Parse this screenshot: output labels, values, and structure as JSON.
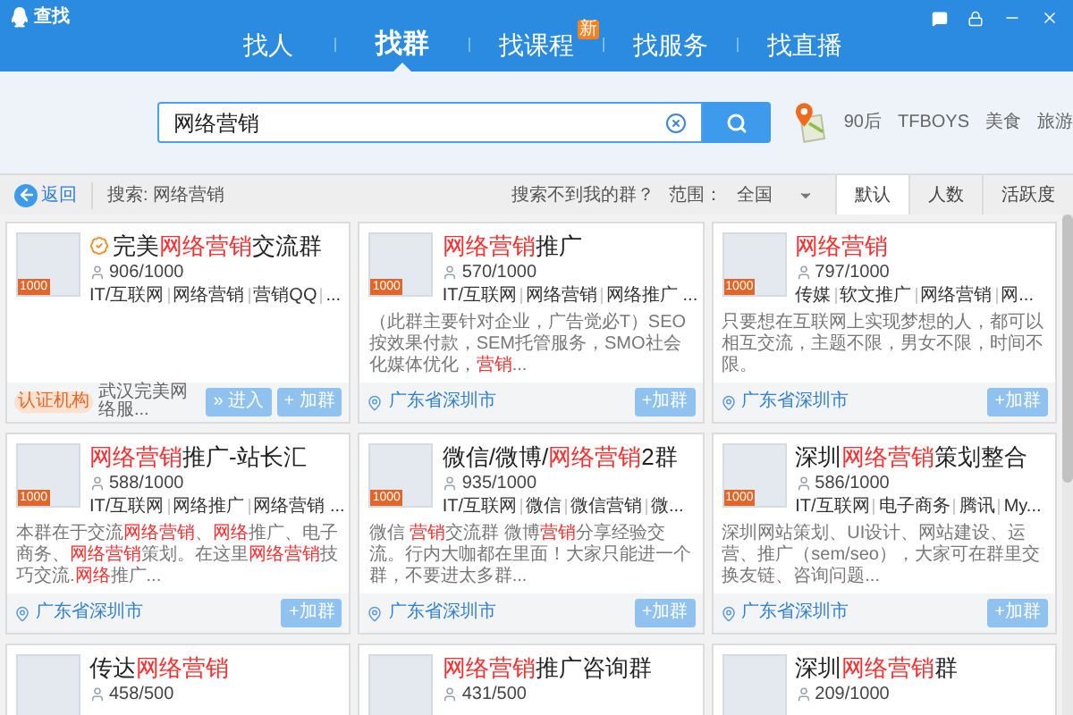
{
  "window": {
    "title": "查找"
  },
  "tabs": [
    {
      "label": "找人",
      "selected": false
    },
    {
      "label": "找群",
      "selected": true
    },
    {
      "label": "找课程",
      "selected": false,
      "badge": "新"
    },
    {
      "label": "找服务",
      "selected": false
    },
    {
      "label": "找直播",
      "selected": false
    }
  ],
  "search": {
    "value": "网络营销"
  },
  "hot_words": [
    "90后",
    "TFBOYS",
    "美食",
    "旅游"
  ],
  "toolbar": {
    "back": "返回",
    "query": "搜索: 网络营销",
    "help_link": "搜索不到我的群？",
    "range_label": "范围：",
    "range_value": "全国",
    "sort_tabs": [
      {
        "label": "默认",
        "selected": true
      },
      {
        "label": "人数",
        "selected": false
      },
      {
        "label": "活跃度",
        "selected": false
      }
    ]
  },
  "groups": [
    {
      "verified": true,
      "title": [
        {
          "text": "完美",
          "highlight": false
        },
        {
          "text": "网络营销",
          "highlight": true
        },
        {
          "text": "交流群",
          "highlight": false
        }
      ],
      "size_badge": "1000",
      "members": "906/1000",
      "tags": [
        "IT/互联网",
        "网络营销",
        "营销QQ",
        "..."
      ],
      "footer": {
        "kind": "certified",
        "badge": "认证机构",
        "text": "武汉完美网络服..."
      },
      "buttons": [
        "» 进入",
        "+ 加群"
      ]
    },
    {
      "verified": false,
      "title": [
        {
          "text": "网络营销",
          "highlight": true
        },
        {
          "text": "推广",
          "highlight": false
        }
      ],
      "size_badge": "1000",
      "members": "570/1000",
      "tags": [
        "IT/互联网",
        "网络营销",
        "网络推广 ..."
      ],
      "description": [
        {
          "text": "（此群主要针对企业，广告觉必T）SEO按效果付款，SEM托管服务，SMO社会化媒体优化，",
          "highlight": false
        },
        {
          "text": "营销",
          "highlight": true
        },
        {
          "text": "...",
          "highlight": false
        }
      ],
      "footer": {
        "kind": "location",
        "text": "广东省深圳市"
      },
      "buttons": [
        "+加群"
      ]
    },
    {
      "verified": false,
      "title": [
        {
          "text": "网络营销",
          "highlight": true
        }
      ],
      "size_badge": "1000",
      "members": "797/1000",
      "tags": [
        "传媒",
        "软文推广",
        "网络营销",
        "网..."
      ],
      "description": [
        {
          "text": "只要想在互联网上实现梦想的人，都可以相互交流，主题不限，男女不限，时间不限。",
          "highlight": false
        }
      ],
      "footer": {
        "kind": "location",
        "text": "广东省深圳市"
      },
      "buttons": [
        "+加群"
      ]
    },
    {
      "verified": false,
      "title": [
        {
          "text": "网络营销",
          "highlight": true
        },
        {
          "text": "推广-站长汇",
          "highlight": false
        }
      ],
      "size_badge": "1000",
      "members": "588/1000",
      "tags": [
        "IT/互联网",
        "网络推广",
        "网络营销 ..."
      ],
      "description": [
        {
          "text": "本群在于交流",
          "highlight": false
        },
        {
          "text": "网络营销",
          "highlight": true
        },
        {
          "text": "、",
          "highlight": false
        },
        {
          "text": "网络",
          "highlight": true
        },
        {
          "text": "推广、电子商务、",
          "highlight": false
        },
        {
          "text": "网络营销",
          "highlight": true
        },
        {
          "text": "策划。在这里",
          "highlight": false
        },
        {
          "text": "网络营销",
          "highlight": true
        },
        {
          "text": "技巧交流.",
          "highlight": false
        },
        {
          "text": "网络",
          "highlight": true
        },
        {
          "text": "推广...",
          "highlight": false
        }
      ],
      "footer": {
        "kind": "location",
        "text": "广东省深圳市"
      },
      "buttons": [
        "+加群"
      ]
    },
    {
      "verified": false,
      "title": [
        {
          "text": "微信/微博/",
          "highlight": false
        },
        {
          "text": "网络营销",
          "highlight": true
        },
        {
          "text": "2群",
          "highlight": false
        }
      ],
      "size_badge": "1000",
      "members": "935/1000",
      "tags": [
        "IT/互联网",
        "微信",
        "微信营销",
        "微..."
      ],
      "description": [
        {
          "text": "微信 ",
          "highlight": false
        },
        {
          "text": "营销",
          "highlight": true
        },
        {
          "text": "交流群 微博",
          "highlight": false
        },
        {
          "text": "营销",
          "highlight": true
        },
        {
          "text": "分享经验交流。行内大咖都在里面！大家只能进一个群，不要进太多群...",
          "highlight": false
        }
      ],
      "footer": {
        "kind": "location",
        "text": "广东省深圳市"
      },
      "buttons": [
        "+加群"
      ]
    },
    {
      "verified": false,
      "title": [
        {
          "text": "深圳",
          "highlight": false
        },
        {
          "text": "网络营销",
          "highlight": true
        },
        {
          "text": "策划整合",
          "highlight": false
        }
      ],
      "size_badge": "1000",
      "members": "586/1000",
      "tags": [
        "IT/互联网",
        "电子商务",
        "腾讯",
        "My..."
      ],
      "description": [
        {
          "text": "深圳网站策划、UI设计、网站建设、运营、推广（sem/seo），大家可在群里交换友链、咨询问题...",
          "highlight": false
        }
      ],
      "footer": {
        "kind": "location",
        "text": "广东省深圳市"
      },
      "buttons": [
        "+加群"
      ]
    },
    {
      "verified": false,
      "title": [
        {
          "text": "传达",
          "highlight": false
        },
        {
          "text": "网络营销",
          "highlight": true
        }
      ],
      "members": "458/500"
    },
    {
      "verified": false,
      "title": [
        {
          "text": "网络营销",
          "highlight": true
        },
        {
          "text": "推广咨询群",
          "highlight": false
        }
      ],
      "members": "431/500"
    },
    {
      "verified": false,
      "title": [
        {
          "text": "深圳",
          "highlight": false
        },
        {
          "text": "网络营销",
          "highlight": true
        },
        {
          "text": "群",
          "highlight": false
        }
      ],
      "members": "209/1000"
    }
  ]
}
